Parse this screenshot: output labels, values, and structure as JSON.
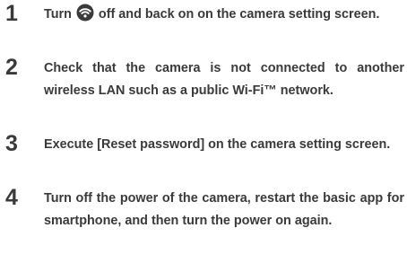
{
  "steps": [
    {
      "number": "1",
      "text_before_icon": "Turn ",
      "icon": "wifi-icon",
      "text_after_icon": " off and back on on the camera setting screen."
    },
    {
      "number": "2",
      "text": "Check that the camera is not connected to an­other wireless LAN such as a public Wi-Fi™ net­work."
    },
    {
      "number": "3",
      "text": "Execute [Reset password] on the camera setting screen."
    },
    {
      "number": "4",
      "text": "Turn off the power of the camera, restart the ba­sic app for smartphone, and then turn the power on again."
    }
  ]
}
